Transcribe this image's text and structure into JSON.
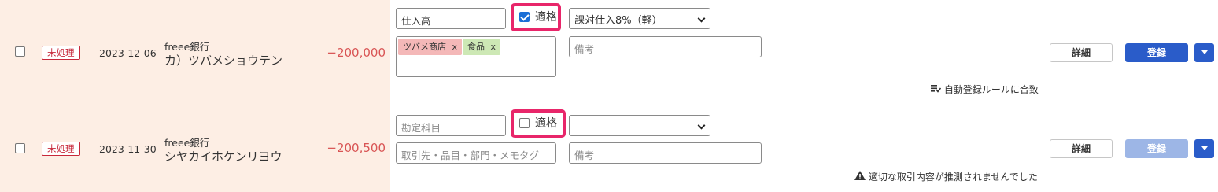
{
  "rows": [
    {
      "status": "未処理",
      "date": "2023-12-06",
      "bank": "freee銀行",
      "payee": "カ）ツバメショウテン",
      "amount": "−200,000",
      "account": {
        "value": "仕入高",
        "placeholder": "勘定科目"
      },
      "qualified": {
        "label": "適格",
        "checked": true
      },
      "tax": "課対仕入8%（軽）",
      "tags": [
        {
          "label": "ツバメ商店",
          "close": "x"
        },
        {
          "label": "食品",
          "close": "x"
        }
      ],
      "memo_placeholder": "備考",
      "detail_label": "詳細",
      "register_label": "登録",
      "note": {
        "icon": "rule-icon",
        "link": "自動登録ルール",
        "suffix": "に合致"
      }
    },
    {
      "status": "未処理",
      "date": "2023-11-30",
      "bank": "freee銀行",
      "payee": "シヤカイホケンリヨウ",
      "amount": "−200,500",
      "account": {
        "value": "",
        "placeholder": "勘定科目"
      },
      "qualified": {
        "label": "適格",
        "checked": false
      },
      "tax": "",
      "tags_placeholder": "取引先・品目・部門・メモタグ",
      "memo_placeholder": "備考",
      "detail_label": "詳細",
      "register_label": "登録",
      "note": {
        "icon": "warning-icon",
        "text": "適切な取引内容が推測されませんでした"
      }
    }
  ],
  "colors": {
    "left_bg": "#fdeee4",
    "accent": "#2a5cc9",
    "highlight": "#e8266a",
    "amount": "#d95555"
  }
}
